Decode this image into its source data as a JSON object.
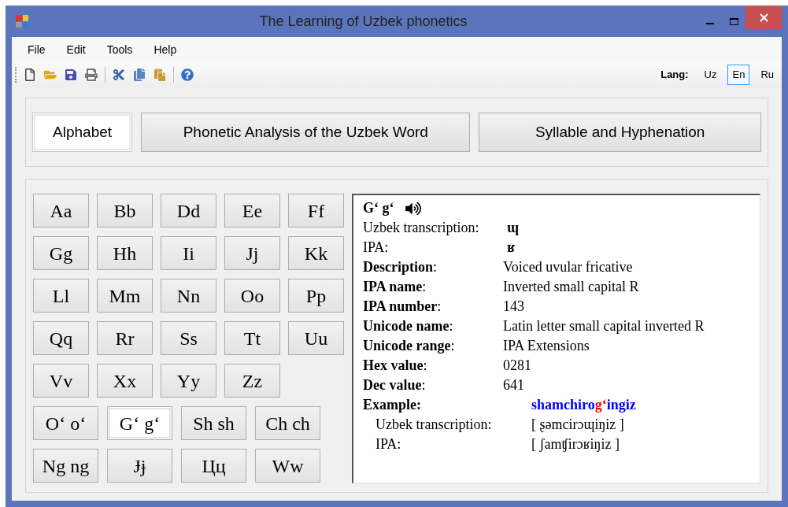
{
  "window": {
    "title": "The Learning of Uzbek phonetics"
  },
  "menu": [
    "File",
    "Edit",
    "Tools",
    "Help"
  ],
  "toolbar": {
    "lang_label": "Lang:",
    "languages": [
      {
        "label": "Uz",
        "selected": false
      },
      {
        "label": "En",
        "selected": true
      },
      {
        "label": "Ru",
        "selected": false
      }
    ]
  },
  "tabs": [
    {
      "label": "Alphabet",
      "selected": true
    },
    {
      "label": "Phonetic Analysis of the Uzbek Word",
      "selected": false
    },
    {
      "label": "Syllable and Hyphenation",
      "selected": false
    }
  ],
  "letter_rows": [
    [
      {
        "label": "Aa",
        "selected": false
      },
      {
        "label": "Bb",
        "selected": false
      },
      {
        "label": "Dd",
        "selected": false
      },
      {
        "label": "Ee",
        "selected": false
      },
      {
        "label": "Ff",
        "selected": false
      }
    ],
    [
      {
        "label": "Gg",
        "selected": false
      },
      {
        "label": "Hh",
        "selected": false
      },
      {
        "label": "Ii",
        "selected": false
      },
      {
        "label": "Jj",
        "selected": false
      },
      {
        "label": "Kk",
        "selected": false
      }
    ],
    [
      {
        "label": "Ll",
        "selected": false
      },
      {
        "label": "Mm",
        "selected": false
      },
      {
        "label": "Nn",
        "selected": false
      },
      {
        "label": "Oo",
        "selected": false
      },
      {
        "label": "Pp",
        "selected": false
      }
    ],
    [
      {
        "label": "Qq",
        "selected": false
      },
      {
        "label": "Rr",
        "selected": false
      },
      {
        "label": "Ss",
        "selected": false
      },
      {
        "label": "Tt",
        "selected": false
      },
      {
        "label": "Uu",
        "selected": false
      }
    ],
    [
      {
        "label": "Vv",
        "selected": false
      },
      {
        "label": "Xx",
        "selected": false
      },
      {
        "label": "Yy",
        "selected": false
      },
      {
        "label": "Zz",
        "selected": false
      }
    ],
    [
      {
        "label": "O‘ o‘",
        "selected": false
      },
      {
        "label": "G‘ g‘",
        "selected": true
      },
      {
        "label": "Sh sh",
        "selected": false
      },
      {
        "label": "Ch ch",
        "selected": false
      }
    ],
    [
      {
        "label": "Ng ng",
        "selected": false
      },
      {
        "label": "Ɉɉ",
        "selected": false
      },
      {
        "label": "Цц",
        "selected": false
      },
      {
        "label": "Ww",
        "selected": false
      }
    ]
  ],
  "info": {
    "letter": "G‘ g‘",
    "header_fields": [
      {
        "label": "Uzbek transcription:",
        "value": "ɰ"
      },
      {
        "label": "IPA:",
        "value": "ʁ"
      }
    ],
    "fields": [
      {
        "label": "**Description**:",
        "value": "Voiced uvular fricative"
      },
      {
        "label": "**IPA name**:",
        "value": "Inverted small capital R"
      },
      {
        "label": "**IPA number**:",
        "value": "143"
      },
      {
        "label": "**Unicode name**:",
        "value": "Latin letter small capital inverted R"
      },
      {
        "label": "**Unicode range**:",
        "value": "IPA Extensions"
      },
      {
        "label": "**Hex value**:",
        "value": "0281"
      },
      {
        "label": "**Dec value**:",
        "value": "641"
      }
    ],
    "example": {
      "label": "Example:",
      "parts": [
        {
          "text": "shamchiro",
          "color": "#0000ff"
        },
        {
          "text": "g‘",
          "color": "#ff0000"
        },
        {
          "text": "ingiz",
          "color": "#0000ff"
        }
      ],
      "rows": [
        {
          "label": "Uzbek transcription:",
          "value": "[ ʂəmcirɔɰiŋiz ]"
        },
        {
          "label": "IPA:",
          "value": "[ ʃamʧirɔʁiŋiz ]"
        }
      ]
    }
  }
}
